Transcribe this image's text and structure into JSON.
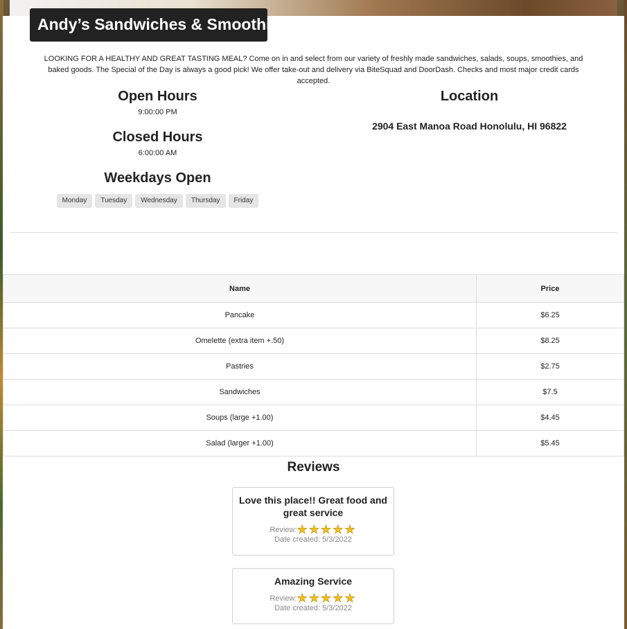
{
  "header": {
    "title": "Andy’s Sandwiches & Smoothies"
  },
  "intro": "LOOKING FOR A HEALTHY AND GREAT TASTING MEAL? Come on in and select from our variety of freshly made sandwiches, salads, soups, smoothies, and baked goods. The Special of the Day is always a good pick! We offer take-out and delivery via BiteSquad and DoorDash. Checks and most major credit cards accepted.",
  "hours": {
    "open_title": "Open Hours",
    "open_value": "9:00:00 PM",
    "closed_title": "Closed Hours",
    "closed_value": "6:00:00 AM",
    "weekdays_title": "Weekdays Open",
    "weekdays": [
      "Monday",
      "Tuesday",
      "Wednesday",
      "Thursday",
      "Friday"
    ]
  },
  "location": {
    "title": "Location",
    "address": "2904 East Manoa Road Honolulu, HI 96822"
  },
  "menu": {
    "headers": [
      "Name",
      "Price"
    ],
    "rows": [
      [
        "Pancake",
        "$6.25"
      ],
      [
        "Omelette (extra item +.50)",
        "$8.25"
      ],
      [
        "Pastries",
        "$2.75"
      ],
      [
        "Sandwiches",
        "$7.5"
      ],
      [
        "Soups (large +1.00)",
        "$4.45"
      ],
      [
        "Salad (larger +1.00)",
        "$5.45"
      ]
    ]
  },
  "reviews": {
    "title": "Reviews",
    "review_label": "Review:",
    "items": [
      {
        "text": "Love this place!! Great food and great service",
        "rating": 5,
        "date": "Date created: 5/3/2022"
      },
      {
        "text": "Amazing Service",
        "rating": 5,
        "date": "Date created: 5/3/2022"
      }
    ]
  }
}
